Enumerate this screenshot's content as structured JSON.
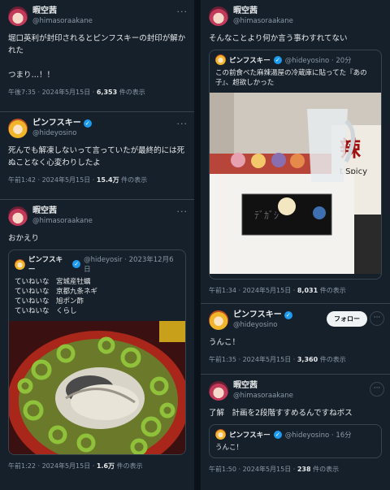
{
  "left": {
    "t1": {
      "name": "暇空茜",
      "handle": "@himasoraakane",
      "text": "堀口英利が封印されるとピンフスキーの封印が解かれた\n\nつまり…！！",
      "time": "午後7:35 · 2024年5月15日 · ",
      "views": "6,353",
      "views_suffix": " 件の表示"
    },
    "t2": {
      "name": "ピンフスキー",
      "handle": "@hideyosino",
      "text": "死んでも解凍しないって言っていたが最終的には死ぬことなく心変わりしたよ",
      "time": "午前1:42 · 2024年5月15日 · ",
      "views": "15.4万",
      "views_suffix": " 件の表示"
    },
    "t3": {
      "name": "暇空茜",
      "handle": "@himasoraakane",
      "text": "おかえり",
      "quote": {
        "name": "ピンフスキー",
        "handle": "@hideyosir · 2023年12月6日",
        "text": "ていねいな　宮城産牡蠣\nていねいな　京都九条ネギ\nていねいな　旭ポン酢\nていねいな　くらし"
      },
      "time": "午前1:22 · 2024年5月15日 · ",
      "views": "1.6万",
      "views_suffix": " 件の表示"
    }
  },
  "right": {
    "t1": {
      "name": "暇空茜",
      "handle": "@himasoraakane",
      "text": "そんなことより何か言う事わすれてない",
      "quote": {
        "name": "ピンフスキー",
        "handle": "@hideyosino · 20分",
        "text": "この前食べた麻辣湯屋の冷蔵庫に貼ってた『あの子』、超欲しかった",
        "sign": "t Spicy"
      },
      "time": "午前1:34 · 2024年5月15日 · ",
      "views": "8,031",
      "views_suffix": " 件の表示"
    },
    "t2": {
      "name": "ピンフスキー",
      "handle": "@hideyosino",
      "follow": "フォロー",
      "text": "うんこ！",
      "time": "午前1:35 · 2024年5月15日 · ",
      "views": "3,360",
      "views_suffix": " 件の表示"
    },
    "t3": {
      "name": "暇空茜",
      "handle": "@himasoraakane",
      "text": "了解　計画を2段階すすめるんですねボス",
      "quote": {
        "name": "ピンフスキー",
        "handle": "@hideyosino · 16分",
        "text": "うんこ！"
      },
      "time": "午前1:50 · 2024年5月15日 · ",
      "views": "238",
      "views_suffix": " 件の表示"
    }
  },
  "icons": {
    "verified": "verified-badge-icon",
    "more": "more-options-icon"
  }
}
